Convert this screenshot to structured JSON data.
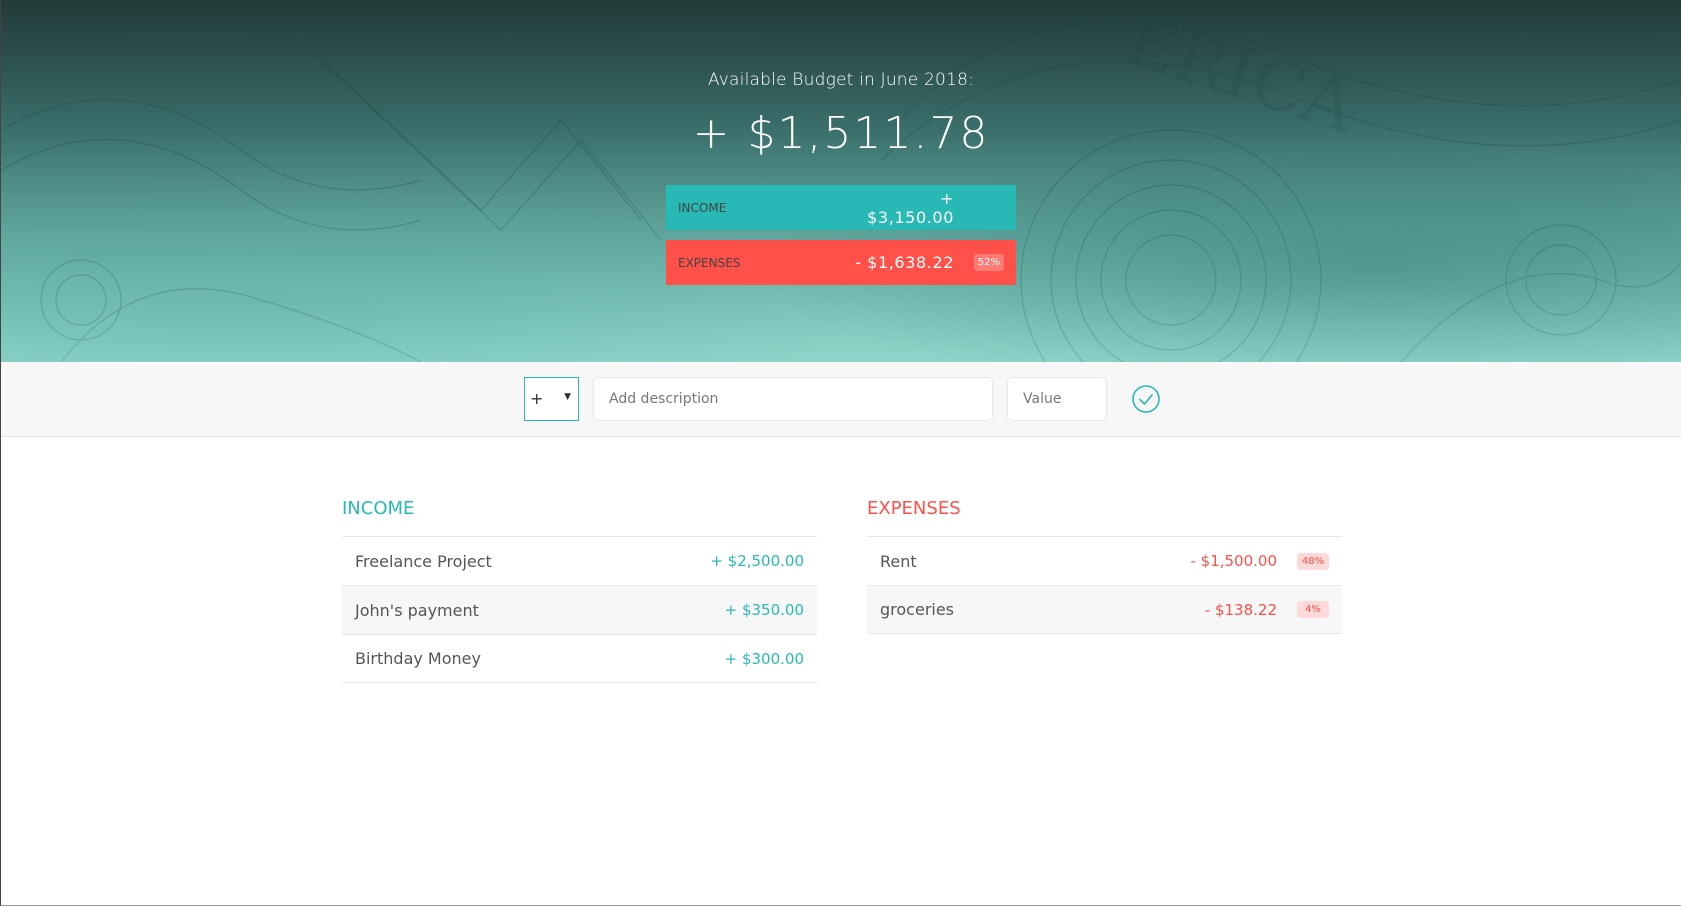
{
  "budget": {
    "title": "Available Budget in June 2018:",
    "value": "+ $1,511.78",
    "income": {
      "label": "Income",
      "value": "+ $3,150.00"
    },
    "expenses": {
      "label": "Expenses",
      "value": "- $1,638.22",
      "percentage": "52%"
    }
  },
  "add_form": {
    "type_value": "+",
    "description_placeholder": "Add description",
    "value_placeholder": "Value",
    "submit_icon": "check-circle-icon"
  },
  "income_list": {
    "title": "Income",
    "items": [
      {
        "description": "Freelance Project",
        "value": "+ $2,500.00"
      },
      {
        "description": "John's payment",
        "value": "+ $350.00"
      },
      {
        "description": "Birthday Money",
        "value": "+ $300.00"
      }
    ]
  },
  "expenses_list": {
    "title": "Expenses",
    "items": [
      {
        "description": "Rent",
        "value": "- $1,500.00",
        "percentage": "48%"
      },
      {
        "description": "groceries",
        "value": "- $138.22",
        "percentage": "4%"
      }
    ]
  },
  "colors": {
    "income": "#28B9B5",
    "expenses": "#FF5049",
    "background_light": "#F7F7F7"
  }
}
